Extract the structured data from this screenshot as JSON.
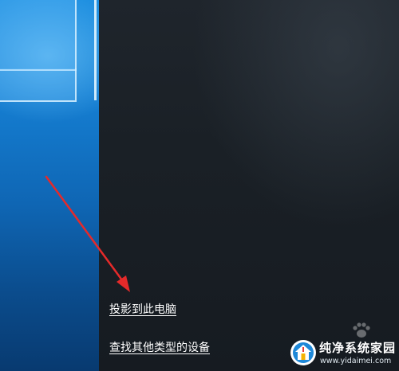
{
  "panel": {
    "project_link": "投影到此电脑",
    "find_devices_link": "查找其他类型的设备"
  },
  "annotation": {
    "arrow_color": "#e52a2a",
    "arrow_icon": "red-arrow-icon"
  },
  "watermark": {
    "title": "纯净系统家园",
    "url": "www.yidaimei.com",
    "logo_icon": "house-logo-icon",
    "logo_color": "#1e88d8"
  },
  "colors": {
    "wallpaper_blue": "#157fd3",
    "panel_dark": "#1a2026",
    "link_text": "#ffffff"
  }
}
